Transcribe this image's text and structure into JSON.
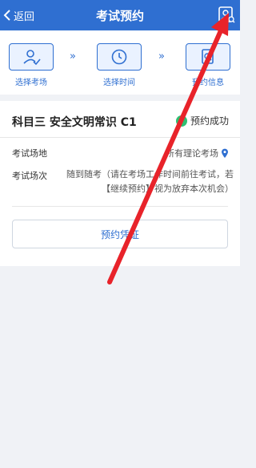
{
  "nav": {
    "back_label": "返回",
    "title": "考试预约",
    "record_icon": "user-record-icon"
  },
  "steps": [
    {
      "label": "选择考场",
      "icon": "user-check-icon"
    },
    {
      "label": "选择时间",
      "icon": "clock-icon"
    },
    {
      "label": "预约信息",
      "icon": "document-search-icon"
    }
  ],
  "step_separator": "»",
  "appointment": {
    "subject": "科目三 安全文明常识 C1",
    "status": "预约成功",
    "venue_label": "考试场地",
    "venue_value": "所有理论考场",
    "session_label": "考试场次",
    "session_value": "随到随考（请在考场工作时间前往考试，若【继续预约】视为放弃本次机会）",
    "voucher_button": "预约凭证"
  },
  "colors": {
    "primary": "#2f6fd1",
    "success": "#2fbf71",
    "annotation_arrow": "#e8232a"
  }
}
